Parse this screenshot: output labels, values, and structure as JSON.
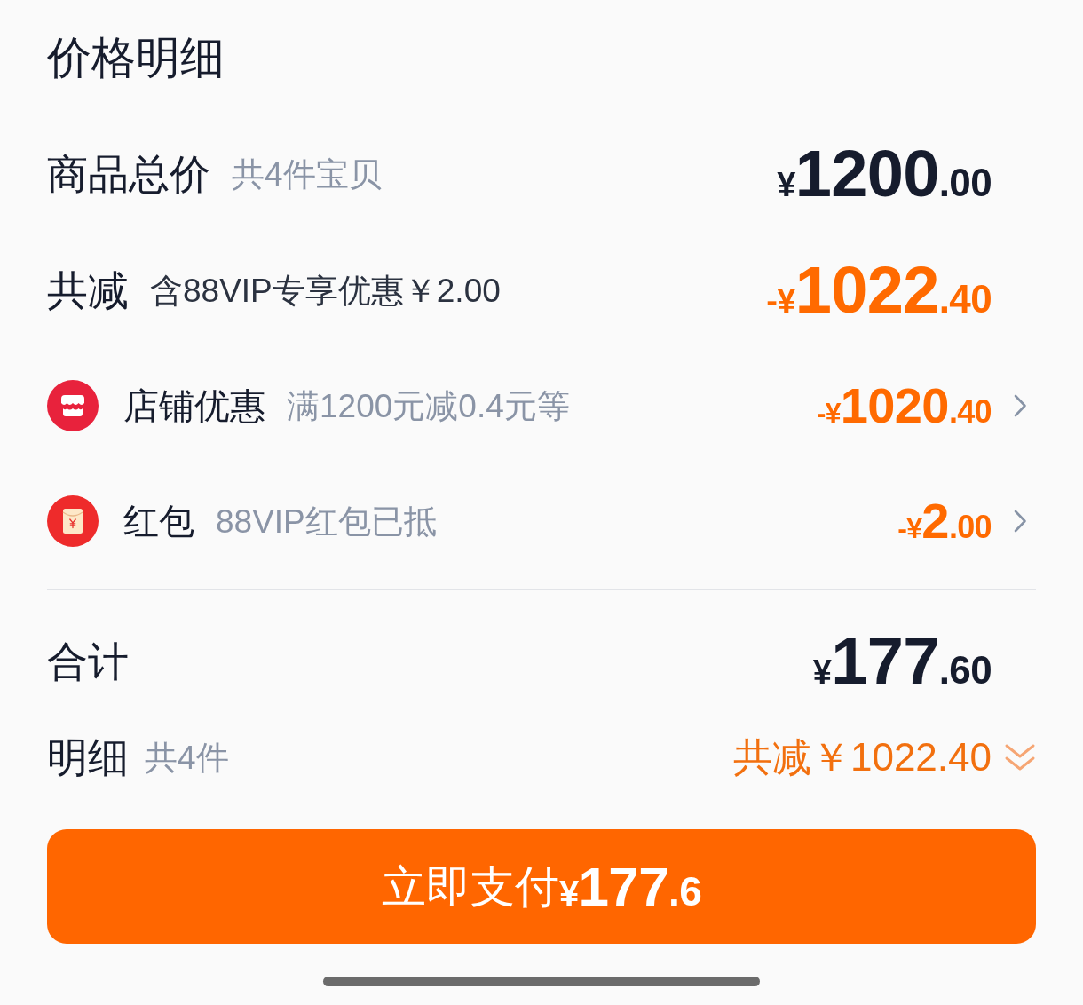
{
  "title": "价格明细",
  "goods_total": {
    "label": "商品总价",
    "note": "共4件宝贝",
    "price": {
      "prefix": "¥",
      "integer": "1200",
      "decimal": ".00"
    }
  },
  "total_discount": {
    "label": "共减",
    "note": "含88VIP专享优惠￥2.00",
    "price": {
      "prefix": "-¥",
      "integer": "1022",
      "decimal": ".40"
    }
  },
  "discounts": [
    {
      "kind": "store",
      "label": "店铺优惠",
      "note": "满1200元减0.4元等",
      "price": {
        "prefix": "-¥",
        "integer": "1020",
        "decimal": ".40"
      }
    },
    {
      "kind": "envelope",
      "label": "红包",
      "note": "88VIP红包已抵",
      "price": {
        "prefix": "-¥",
        "integer": "2",
        "decimal": ".00"
      }
    }
  ],
  "sum": {
    "label": "合计",
    "price": {
      "prefix": "¥",
      "integer": "177",
      "decimal": ".60"
    }
  },
  "details": {
    "label": "明细",
    "note": "共4件",
    "discount": "共减￥1022.40"
  },
  "pay_button": {
    "label": "立即支付",
    "price": {
      "prefix": "¥",
      "integer": "177",
      "decimal": ".6"
    }
  }
}
